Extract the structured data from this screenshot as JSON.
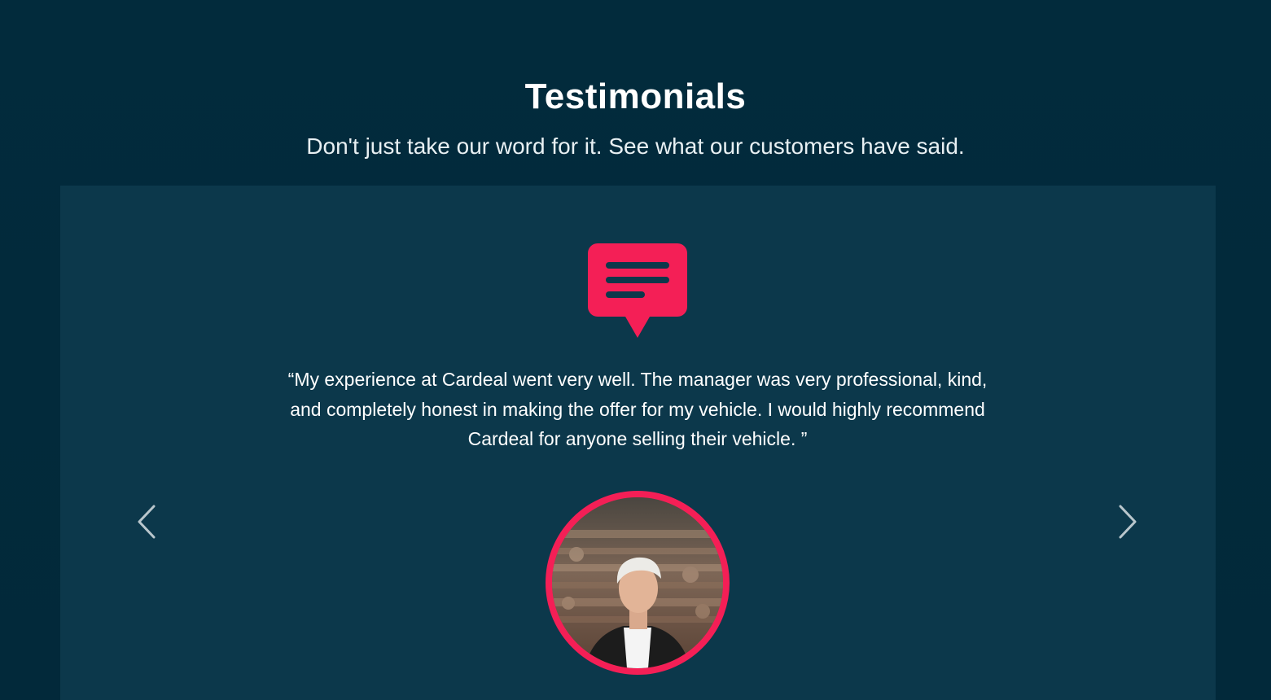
{
  "section": {
    "title": "Testimonials",
    "subtitle": "Don't just take our word for it. See what our customers have said."
  },
  "testimonial": {
    "icon": "chat-bubble-icon",
    "quote": "“My experience at Cardeal went very well. The manager was very professional, kind, and completely honest in making the offer for my vehicle. I would highly recommend Cardeal for anyone selling their vehicle. ”",
    "avatar": "customer-avatar"
  },
  "carousel": {
    "prev_icon": "chevron-left-icon",
    "next_icon": "chevron-right-icon"
  },
  "colors": {
    "background": "#022a3b",
    "card": "#0c384b",
    "accent": "#f41f56",
    "text": "#ffffff"
  }
}
